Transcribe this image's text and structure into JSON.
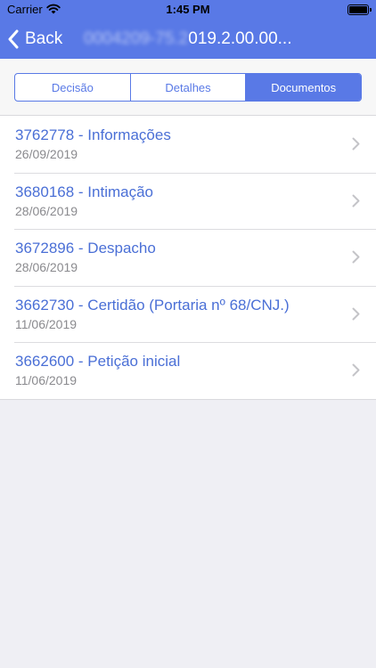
{
  "status": {
    "carrier": "Carrier",
    "time": "1:45 PM"
  },
  "nav": {
    "back_label": "Back",
    "title_blurred": "0004209-75.2",
    "title_visible": "019.2.00.00..."
  },
  "segments": [
    {
      "label": "Decisão",
      "active": false
    },
    {
      "label": "Detalhes",
      "active": false
    },
    {
      "label": "Documentos",
      "active": true
    }
  ],
  "documents": [
    {
      "title": "3762778 - Informações",
      "date": "26/09/2019"
    },
    {
      "title": "3680168 - Intimação",
      "date": "28/06/2019"
    },
    {
      "title": "3672896 - Despacho",
      "date": "28/06/2019"
    },
    {
      "title": "3662730 - Certidão (Portaria nº 68/CNJ.)",
      "date": "11/06/2019"
    },
    {
      "title": "3662600 - Petição inicial",
      "date": "11/06/2019"
    }
  ],
  "colors": {
    "accent": "#5979e6",
    "link": "#4a6fd6",
    "background": "#efeff4"
  }
}
